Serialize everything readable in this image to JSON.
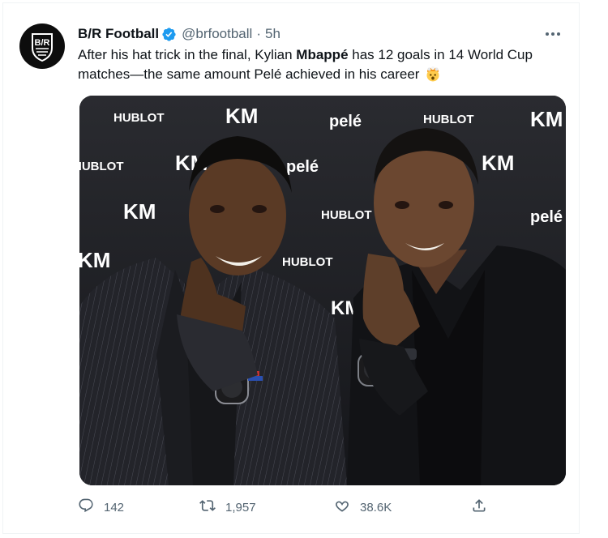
{
  "tweet": {
    "author": {
      "display_name": "B/R Football",
      "handle": "@brfootball",
      "time": "5h",
      "verified": true,
      "avatar_text": "B/R"
    },
    "text_before": "After his hat trick in the final, Kylian ",
    "text_bold": "Mbappé",
    "text_after": " has 12 goals in 14 World Cup matches—the same amount Pelé achieved in his career",
    "emoji": "exploding-head-emoji",
    "media": {
      "backdrop_words": [
        "HUBLOT",
        "KM",
        "pelé"
      ]
    },
    "actions": {
      "replies": "142",
      "retweets": "1,957",
      "likes": "38.6K"
    }
  },
  "colors": {
    "verified_blue": "#1d9bf0",
    "secondary_text": "#536471",
    "primary_text": "#0f1419"
  },
  "icons": {
    "avatar": "br-football-logo",
    "verified": "verified-badge-icon",
    "more": "more-options-icon",
    "reply": "reply-icon",
    "retweet": "retweet-icon",
    "like": "heart-icon",
    "share": "share-icon"
  }
}
